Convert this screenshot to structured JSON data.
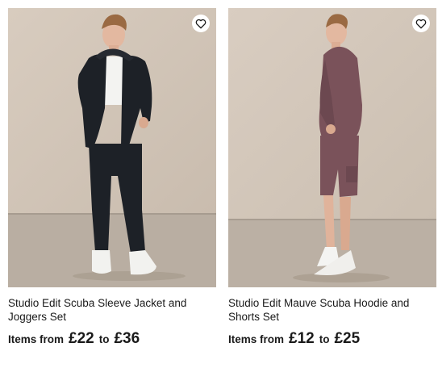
{
  "products": [
    {
      "title": "Studio Edit Scuba Sleeve Jacket and Joggers Set",
      "price_label": "Items from",
      "price_from": "£22",
      "price_to_word": "to",
      "price_to": "£36",
      "wishlist_icon": "heart-outline-icon",
      "outfit_color": "#1d2127"
    },
    {
      "title": "Studio Edit Mauve Scuba Hoodie and Shorts Set",
      "price_label": "Items from",
      "price_from": "£12",
      "price_to_word": "to",
      "price_to": "£25",
      "wishlist_icon": "heart-outline-icon",
      "outfit_color": "#7a525a"
    }
  ]
}
